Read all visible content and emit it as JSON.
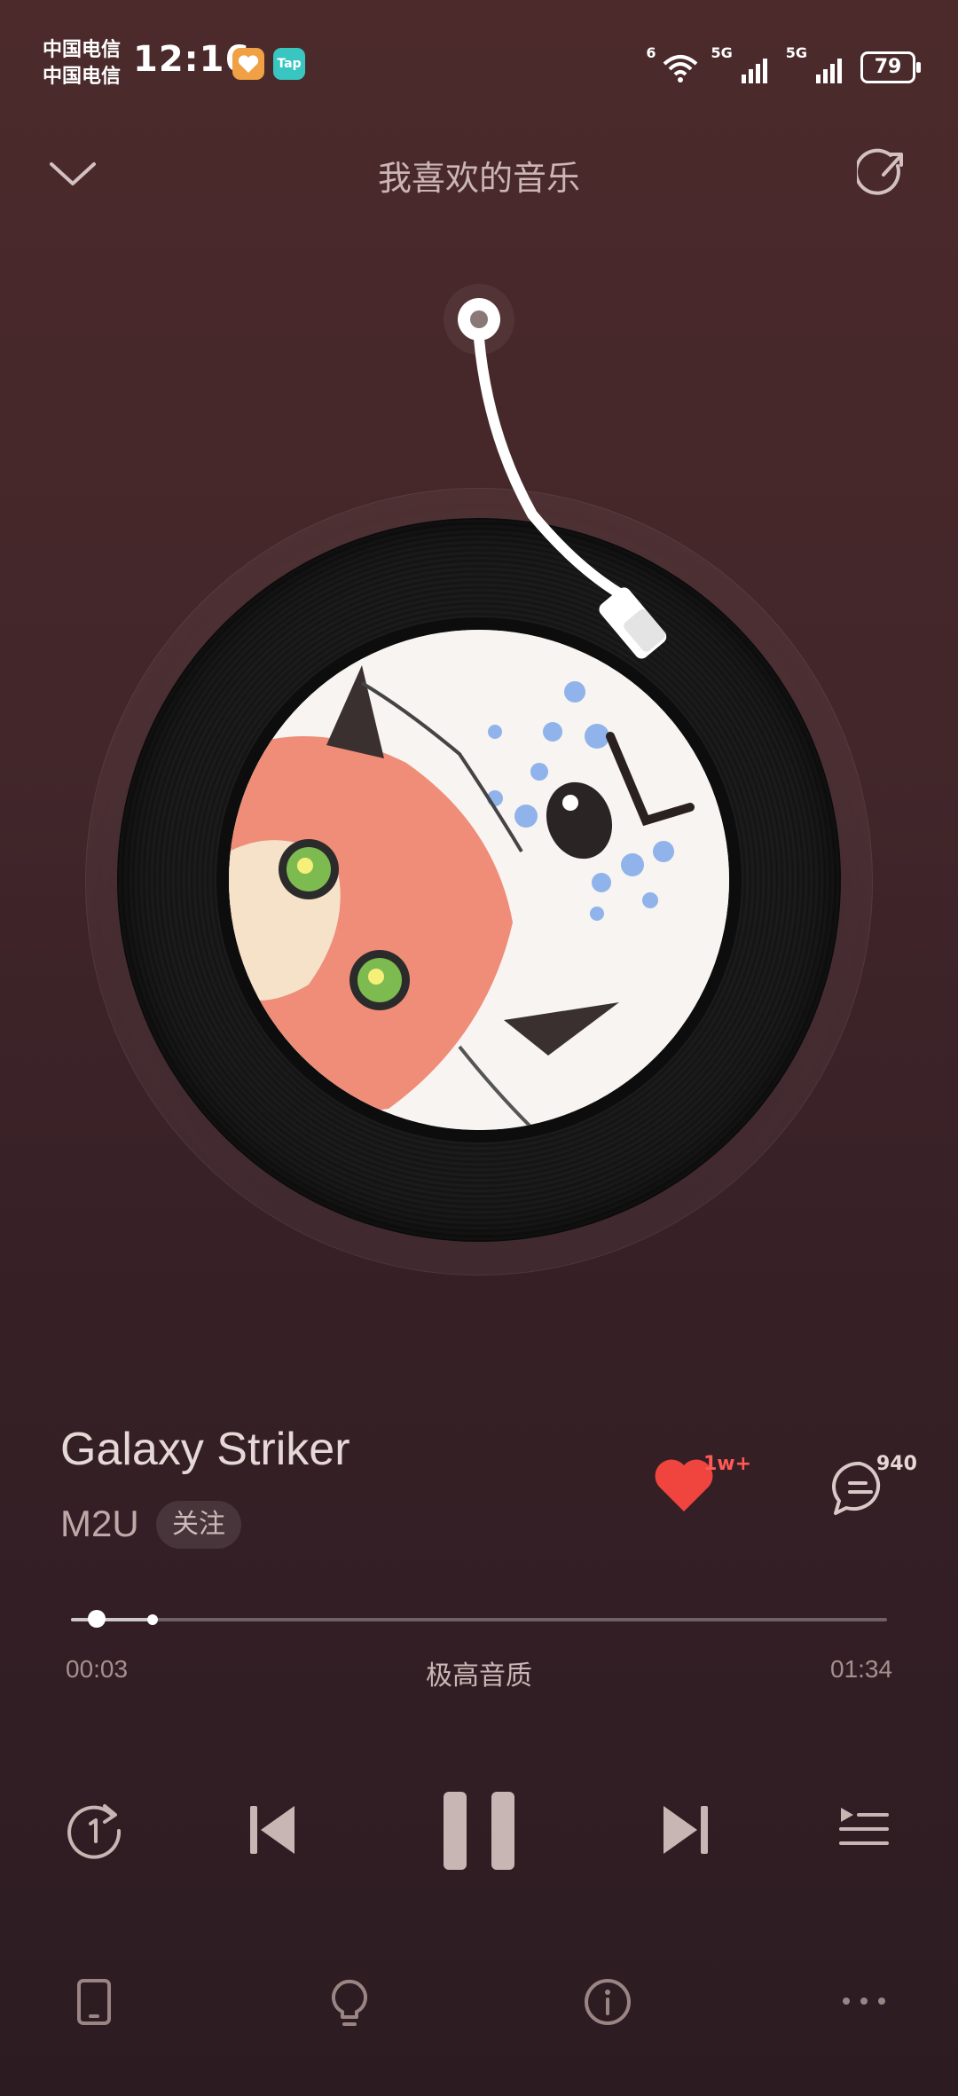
{
  "status_bar": {
    "carrier_1": "中国电信",
    "carrier_2": "中国电信",
    "time": "12:16",
    "tap_badge": "Tap",
    "wifi_label": "6",
    "sim1_label": "5G",
    "sim2_label": "5G",
    "battery": "79"
  },
  "header": {
    "title": "我喜欢的音乐",
    "collapse_icon": "chevron-down-icon",
    "share_icon": "share-icon"
  },
  "song": {
    "title": "Galaxy Striker",
    "artist": "M2U",
    "follow_label": "关注",
    "like_count": "1w+",
    "comment_count": "940",
    "liked": true
  },
  "progress": {
    "current": "00:03",
    "total": "01:34",
    "quality": "极高音质"
  },
  "controls": {
    "repeat_icon": "repeat-one-icon",
    "prev_icon": "previous-icon",
    "play_state_icon": "pause-icon",
    "next_icon": "next-icon",
    "playlist_icon": "playlist-icon"
  },
  "bottom_bar": {
    "icons": [
      "device-icon",
      "lightbulb-icon",
      "info-icon",
      "more-icon"
    ]
  },
  "colors": {
    "accent_like": "#f0443f",
    "background_top": "#4c2a2b",
    "background_bottom": "#2c1c22"
  }
}
